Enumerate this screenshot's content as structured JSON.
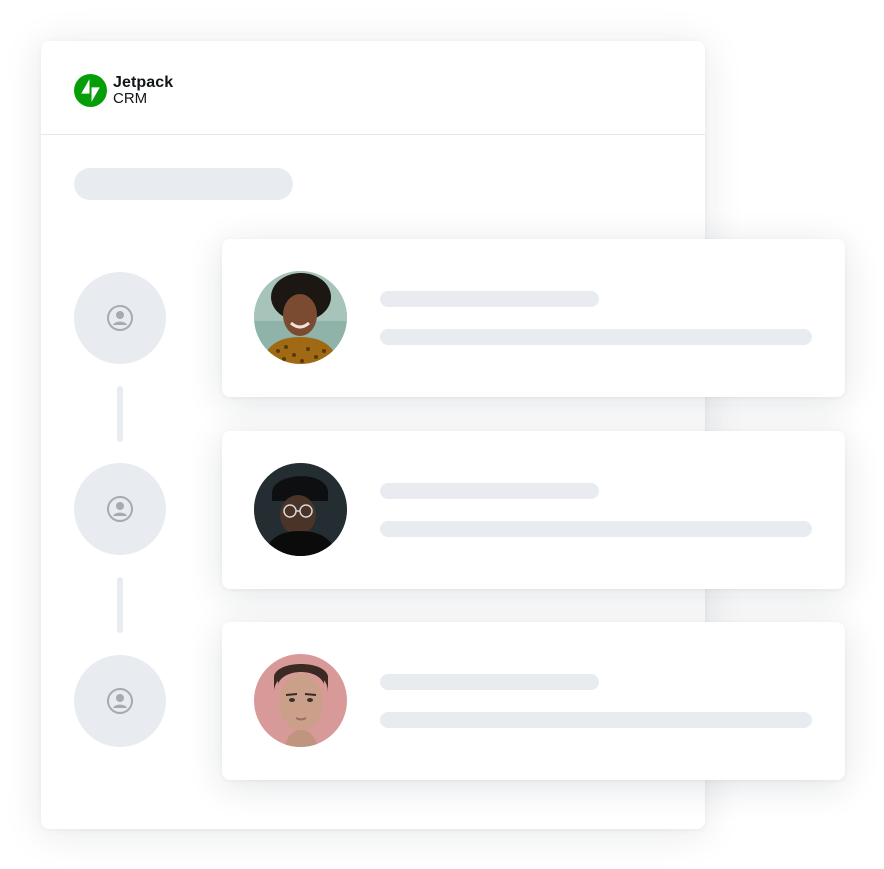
{
  "app": {
    "logo_word": "Jetpack",
    "logo_sub": "CRM",
    "brand_color": "#069e08",
    "skeleton_color": "#e8ecf1"
  },
  "timeline": {
    "node_icon": "user-circle-icon",
    "entries": [
      {
        "avatar": "avatar-photo-woman-curly-hair"
      },
      {
        "avatar": "avatar-photo-man-beanie-glasses"
      },
      {
        "avatar": "avatar-photo-person-pink-background"
      }
    ]
  }
}
